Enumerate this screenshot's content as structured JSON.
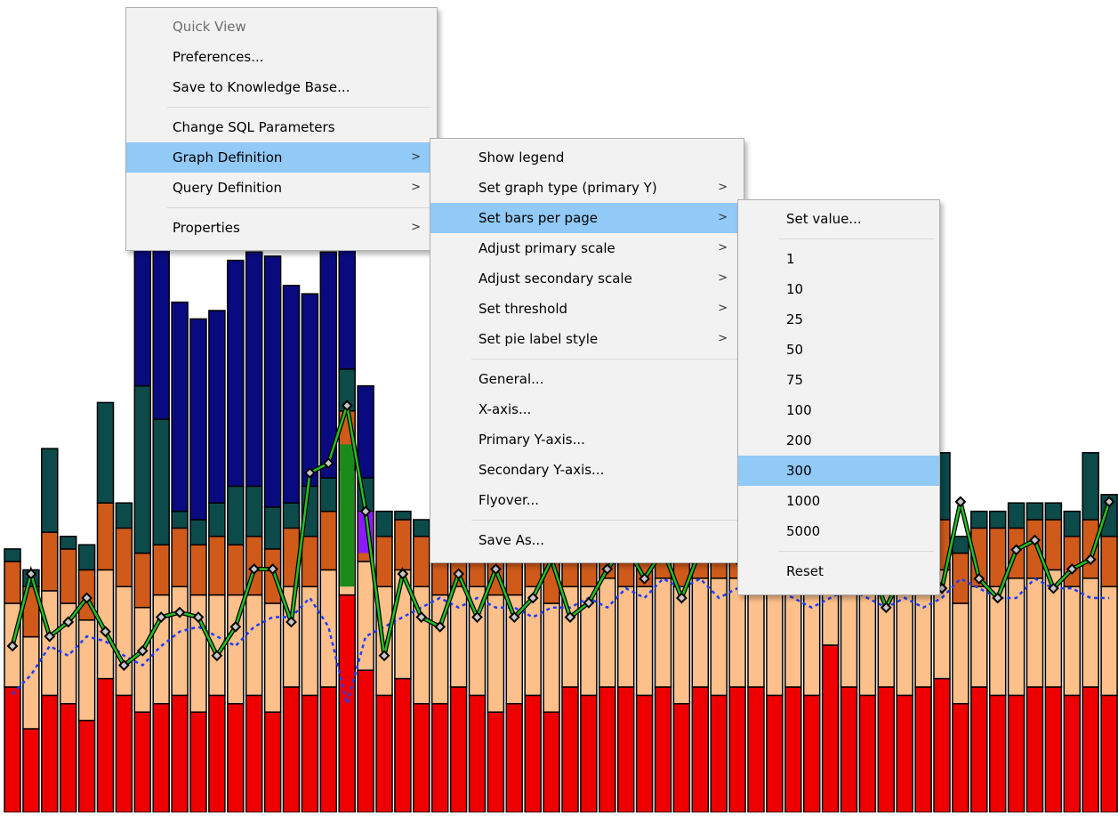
{
  "context_menu": {
    "items": [
      {
        "label": "Quick View",
        "disabled": true
      },
      {
        "label": "Preferences..."
      },
      {
        "label": "Save to Knowledge Base..."
      },
      {
        "separator": true
      },
      {
        "label": "Change SQL Parameters"
      },
      {
        "label": "Graph Definition",
        "submenu": true,
        "highlighted": true
      },
      {
        "label": "Query Definition",
        "submenu": true
      },
      {
        "separator": true
      },
      {
        "label": "Properties",
        "submenu": true
      }
    ]
  },
  "graph_definition_menu": {
    "items": [
      {
        "label": "Show legend"
      },
      {
        "label": "Set graph type (primary Y)",
        "submenu": true
      },
      {
        "label": "Set bars per page",
        "submenu": true,
        "highlighted": true
      },
      {
        "label": "Adjust primary scale",
        "submenu": true
      },
      {
        "label": "Adjust secondary scale",
        "submenu": true
      },
      {
        "label": "Set threshold",
        "submenu": true
      },
      {
        "label": "Set pie label style",
        "submenu": true
      },
      {
        "separator": true
      },
      {
        "label": "General..."
      },
      {
        "label": "X-axis..."
      },
      {
        "label": "Primary Y-axis..."
      },
      {
        "label": "Secondary Y-axis..."
      },
      {
        "label": "Flyover..."
      },
      {
        "separator": true
      },
      {
        "label": "Save As..."
      }
    ]
  },
  "bars_per_page_menu": {
    "items": [
      {
        "label": "Set value..."
      },
      {
        "separator": true
      },
      {
        "label": "1"
      },
      {
        "label": "10"
      },
      {
        "label": "25"
      },
      {
        "label": "50"
      },
      {
        "label": "75"
      },
      {
        "label": "100"
      },
      {
        "label": "200"
      },
      {
        "label": "300",
        "highlighted": true
      },
      {
        "label": "1000"
      },
      {
        "label": "5000"
      },
      {
        "separator": true
      },
      {
        "label": "Reset"
      }
    ]
  },
  "submenu_arrow": ">",
  "chart_data": {
    "type": "bar",
    "stacked": true,
    "grid": false,
    "legend": "none",
    "colors": {
      "red": "#ee0000",
      "peach": "#fdc08a",
      "orange": "#cf5a1a",
      "teal": "#0d4a4a",
      "navy": "#0a0a80",
      "green": "#1a8a1a",
      "purple": "#8a1aff",
      "blue_line": "#1e3cff",
      "green_line": "#22c022"
    },
    "note_values": "approximate values in chart units (0 = bottom, 100 = top of tallest bar)",
    "series_order": [
      "red",
      "peach",
      "orange",
      "teal",
      "navy"
    ],
    "bars": [
      [
        30,
        20,
        10,
        3,
        0
      ],
      [
        20,
        22,
        12,
        4,
        0
      ],
      [
        28,
        25,
        14,
        20,
        0
      ],
      [
        26,
        24,
        13,
        3,
        0
      ],
      [
        22,
        24,
        12,
        6,
        0
      ],
      [
        32,
        26,
        16,
        24,
        0
      ],
      [
        28,
        26,
        14,
        6,
        0
      ],
      [
        24,
        25,
        13,
        40,
        54
      ],
      [
        26,
        26,
        12,
        30,
        55
      ],
      [
        28,
        26,
        14,
        4,
        50
      ],
      [
        24,
        28,
        12,
        6,
        48
      ],
      [
        28,
        24,
        14,
        8,
        46
      ],
      [
        26,
        26,
        12,
        14,
        54
      ],
      [
        28,
        24,
        14,
        12,
        56
      ],
      [
        24,
        26,
        13,
        10,
        60
      ],
      [
        30,
        24,
        14,
        6,
        52
      ],
      [
        28,
        26,
        12,
        12,
        46
      ],
      [
        30,
        28,
        14,
        8,
        54
      ],
      [
        52,
        30,
        14,
        10,
        72
      ],
      [
        34,
        26,
        12,
        8,
        22
      ],
      [
        28,
        26,
        12,
        6,
        0
      ],
      [
        32,
        26,
        12,
        2,
        0
      ],
      [
        26,
        28,
        12,
        4,
        0
      ],
      [
        26,
        26,
        12,
        6,
        0
      ],
      [
        30,
        24,
        14,
        4,
        0
      ],
      [
        28,
        26,
        12,
        40,
        0
      ],
      [
        24,
        28,
        12,
        6,
        0
      ],
      [
        26,
        26,
        13,
        4,
        0
      ],
      [
        28,
        26,
        12,
        4,
        0
      ],
      [
        24,
        26,
        13,
        3,
        0
      ],
      [
        30,
        24,
        12,
        4,
        0
      ],
      [
        28,
        26,
        14,
        3,
        0
      ],
      [
        30,
        26,
        12,
        4,
        0
      ],
      [
        30,
        24,
        12,
        4,
        0
      ],
      [
        28,
        26,
        12,
        3,
        0
      ],
      [
        30,
        26,
        12,
        4,
        0
      ],
      [
        26,
        28,
        12,
        4,
        0
      ],
      [
        30,
        26,
        12,
        4,
        0
      ],
      [
        28,
        28,
        12,
        4,
        0
      ],
      [
        30,
        26,
        12,
        4,
        0
      ],
      [
        30,
        26,
        12,
        6,
        0
      ],
      [
        28,
        28,
        12,
        6,
        0
      ],
      [
        30,
        26,
        12,
        20,
        0
      ],
      [
        28,
        26,
        14,
        6,
        0
      ],
      [
        40,
        24,
        12,
        4,
        0
      ],
      [
        30,
        26,
        12,
        4,
        0
      ],
      [
        28,
        26,
        12,
        6,
        0
      ],
      [
        30,
        26,
        14,
        4,
        0
      ],
      [
        28,
        26,
        12,
        4,
        0
      ],
      [
        30,
        26,
        14,
        8,
        0
      ],
      [
        32,
        26,
        12,
        16,
        0
      ],
      [
        26,
        24,
        12,
        4,
        0
      ],
      [
        30,
        24,
        14,
        4,
        0
      ],
      [
        28,
        26,
        14,
        4,
        0
      ],
      [
        28,
        28,
        12,
        6,
        0
      ],
      [
        30,
        26,
        14,
        4,
        0
      ],
      [
        30,
        28,
        12,
        4,
        0
      ],
      [
        28,
        26,
        12,
        6,
        0
      ],
      [
        30,
        26,
        14,
        16,
        0
      ],
      [
        28,
        26,
        12,
        10,
        0
      ]
    ],
    "line_values": [
      42,
      57,
      44,
      47,
      52,
      45,
      38,
      41,
      48,
      49,
      48,
      40,
      46,
      58,
      58,
      47,
      78,
      80,
      92,
      70,
      40,
      57,
      48,
      46,
      57,
      48,
      58,
      48,
      52,
      60,
      48,
      51,
      58,
      63,
      56,
      62,
      52,
      62,
      62,
      60,
      54,
      64,
      56,
      103,
      88,
      73,
      60,
      50,
      58,
      60,
      54,
      72,
      56,
      52,
      62,
      64,
      54,
      58,
      60,
      72
    ],
    "line2_values": [
      32,
      36,
      42,
      40,
      44,
      43,
      40,
      38,
      42,
      45,
      46,
      44,
      42,
      46,
      48,
      48,
      52,
      46,
      30,
      44,
      46,
      48,
      50,
      52,
      50,
      52,
      50,
      50,
      48,
      50,
      50,
      52,
      50,
      54,
      52,
      56,
      54,
      56,
      52,
      54,
      54,
      54,
      52,
      50,
      52,
      54,
      52,
      50,
      52,
      50,
      52,
      56,
      54,
      52,
      52,
      56,
      54,
      54,
      52,
      52
    ]
  }
}
